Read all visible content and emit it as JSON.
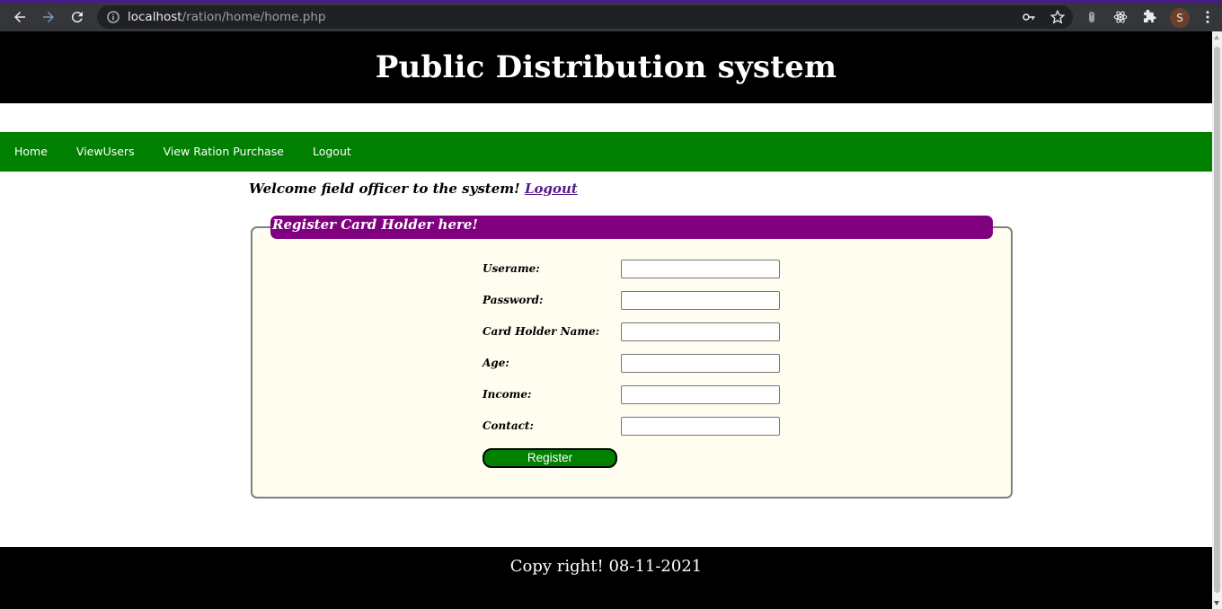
{
  "browser": {
    "url_host": "localhost",
    "url_path": "/ration/home/home.php",
    "profile_initial": "S"
  },
  "page": {
    "title": "Public Distribution system",
    "menu": [
      "Home",
      "ViewUsers",
      "View Ration Purchase",
      "Logout"
    ],
    "welcome_text": "Welcome field officer to the system!",
    "welcome_link": "Logout",
    "form": {
      "legend": "Register Card Holder here!",
      "fields": [
        {
          "label": "Userame:",
          "value": ""
        },
        {
          "label": "Password:",
          "value": ""
        },
        {
          "label": "Card Holder Name:",
          "value": ""
        },
        {
          "label": "Age:",
          "value": ""
        },
        {
          "label": "Income:",
          "value": ""
        },
        {
          "label": "Contact:",
          "value": ""
        }
      ],
      "submit_label": "Register"
    },
    "footer": "Copy right! 08-11-2021"
  },
  "colors": {
    "header_bg": "#000000",
    "menu_bg": "#008000",
    "legend_bg": "#800080",
    "fieldset_bg": "#fffdef",
    "button_bg": "#008000",
    "link": "#551a8b"
  }
}
